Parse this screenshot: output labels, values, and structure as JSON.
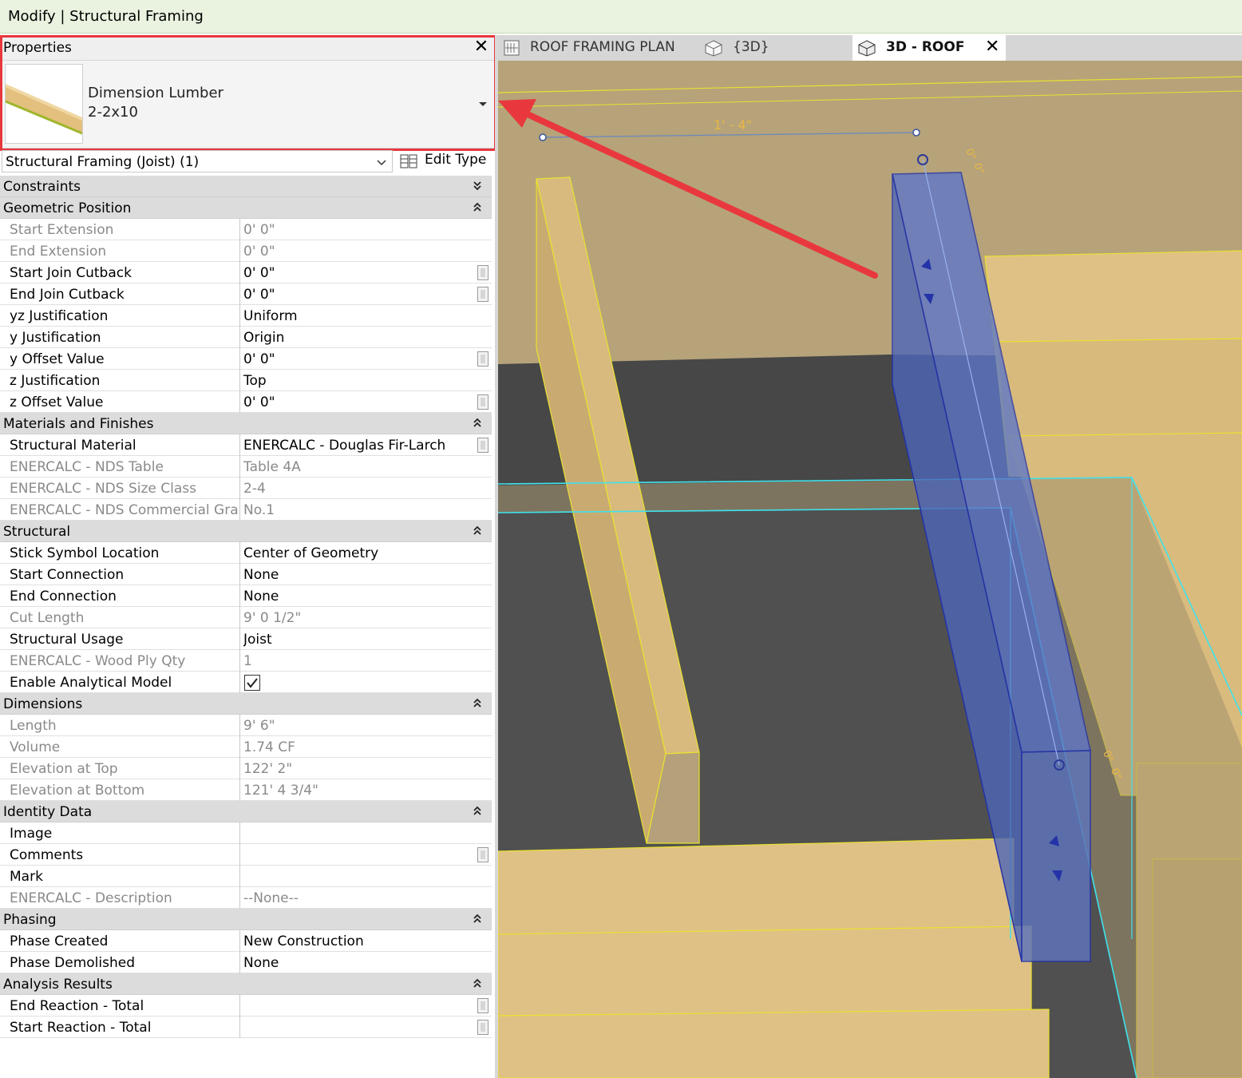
{
  "ribbon": {
    "title": "Modify | Structural Framing"
  },
  "properties": {
    "title": "Properties",
    "close": "✕",
    "type_selector": {
      "family": "Dimension Lumber",
      "type": "2-2x10"
    },
    "instance_filter": "Structural Framing (Joist) (1)",
    "edit_type": "Edit Type",
    "groups": [
      {
        "label": "Constraints",
        "collapsed": true,
        "rows": []
      },
      {
        "label": "Geometric Position",
        "collapsed": false,
        "rows": [
          {
            "name": "Start Extension",
            "value": "0'  0\"",
            "readonly": true,
            "button": false
          },
          {
            "name": "End Extension",
            "value": "0'  0\"",
            "readonly": true,
            "button": false
          },
          {
            "name": "Start Join Cutback",
            "value": "0'  0\"",
            "readonly": false,
            "button": true
          },
          {
            "name": "End Join Cutback",
            "value": "0'  0\"",
            "readonly": false,
            "button": true
          },
          {
            "name": "yz Justification",
            "value": "Uniform",
            "readonly": false,
            "button": false
          },
          {
            "name": "y Justification",
            "value": "Origin",
            "readonly": false,
            "button": false
          },
          {
            "name": "y Offset Value",
            "value": "0'  0\"",
            "readonly": false,
            "button": true
          },
          {
            "name": "z Justification",
            "value": "Top",
            "readonly": false,
            "button": false
          },
          {
            "name": "z Offset Value",
            "value": "0'  0\"",
            "readonly": false,
            "button": true
          }
        ]
      },
      {
        "label": "Materials and Finishes",
        "collapsed": false,
        "rows": [
          {
            "name": "Structural Material",
            "value": "ENERCALC - Douglas Fir-Larch",
            "readonly": false,
            "button": true
          },
          {
            "name": "ENERCALC - NDS Table",
            "value": "Table 4A",
            "readonly": true,
            "button": false
          },
          {
            "name": "ENERCALC - NDS Size Class",
            "value": "2-4",
            "readonly": true,
            "button": false
          },
          {
            "name": "ENERCALC - NDS Commercial Gra...",
            "value": "No.1",
            "readonly": true,
            "button": false
          }
        ]
      },
      {
        "label": "Structural",
        "collapsed": false,
        "rows": [
          {
            "name": "Stick Symbol Location",
            "value": "Center of Geometry",
            "readonly": false,
            "button": false
          },
          {
            "name": "Start Connection",
            "value": "None",
            "readonly": false,
            "button": false
          },
          {
            "name": "End Connection",
            "value": "None",
            "readonly": false,
            "button": false
          },
          {
            "name": "Cut Length",
            "value": "9'  0 1/2\"",
            "readonly": true,
            "button": false
          },
          {
            "name": "Structural Usage",
            "value": "Joist",
            "readonly": false,
            "button": false
          },
          {
            "name": "ENERCALC - Wood Ply Qty",
            "value": "1",
            "readonly": true,
            "button": false
          },
          {
            "name": "Enable Analytical Model",
            "value": "",
            "readonly": false,
            "button": false,
            "checkbox": true,
            "checked": true
          }
        ]
      },
      {
        "label": "Dimensions",
        "collapsed": false,
        "rows": [
          {
            "name": "Length",
            "value": "9'  6\"",
            "readonly": true,
            "button": false
          },
          {
            "name": "Volume",
            "value": "1.74 CF",
            "readonly": true,
            "button": false
          },
          {
            "name": "Elevation at Top",
            "value": "122'  2\"",
            "readonly": true,
            "button": false
          },
          {
            "name": "Elevation at Bottom",
            "value": "121'  4 3/4\"",
            "readonly": true,
            "button": false
          }
        ]
      },
      {
        "label": "Identity Data",
        "collapsed": false,
        "rows": [
          {
            "name": "Image",
            "value": "",
            "readonly": false,
            "button": false
          },
          {
            "name": "Comments",
            "value": "",
            "readonly": false,
            "button": true
          },
          {
            "name": "Mark",
            "value": "",
            "readonly": false,
            "button": false
          },
          {
            "name": "ENERCALC - Description",
            "value": "--None--",
            "readonly": true,
            "button": false
          }
        ]
      },
      {
        "label": "Phasing",
        "collapsed": false,
        "rows": [
          {
            "name": "Phase Created",
            "value": "New Construction",
            "readonly": false,
            "button": false
          },
          {
            "name": "Phase Demolished",
            "value": "None",
            "readonly": false,
            "button": false
          }
        ]
      },
      {
        "label": "Analysis Results",
        "collapsed": false,
        "rows": [
          {
            "name": "End Reaction - Total",
            "value": "",
            "readonly": false,
            "button": true
          },
          {
            "name": "Start Reaction - Total",
            "value": "",
            "readonly": false,
            "button": true
          }
        ]
      }
    ]
  },
  "view_tabs": [
    {
      "label": "ROOF FRAMING PLAN",
      "icon": "plan-view-icon",
      "active": false
    },
    {
      "label": "{3D}",
      "icon": "3d-view-icon",
      "active": false
    },
    {
      "label": "3D - ROOF",
      "icon": "3d-view-icon",
      "active": true,
      "close": "✕"
    }
  ],
  "viewport": {
    "dimension_label": "1' - 4\"",
    "offset_labels": [
      "0\"",
      "0\"",
      "0\"",
      "0\""
    ]
  },
  "colors": {
    "ribbon": "#e9f3df",
    "highlight": "#e8383d",
    "lumber": "#dfc185",
    "lumber_edge": "#e8e230",
    "selection": "#5d76c9",
    "work_plane": "#3fe2ec",
    "dimension": "#e9b743"
  }
}
